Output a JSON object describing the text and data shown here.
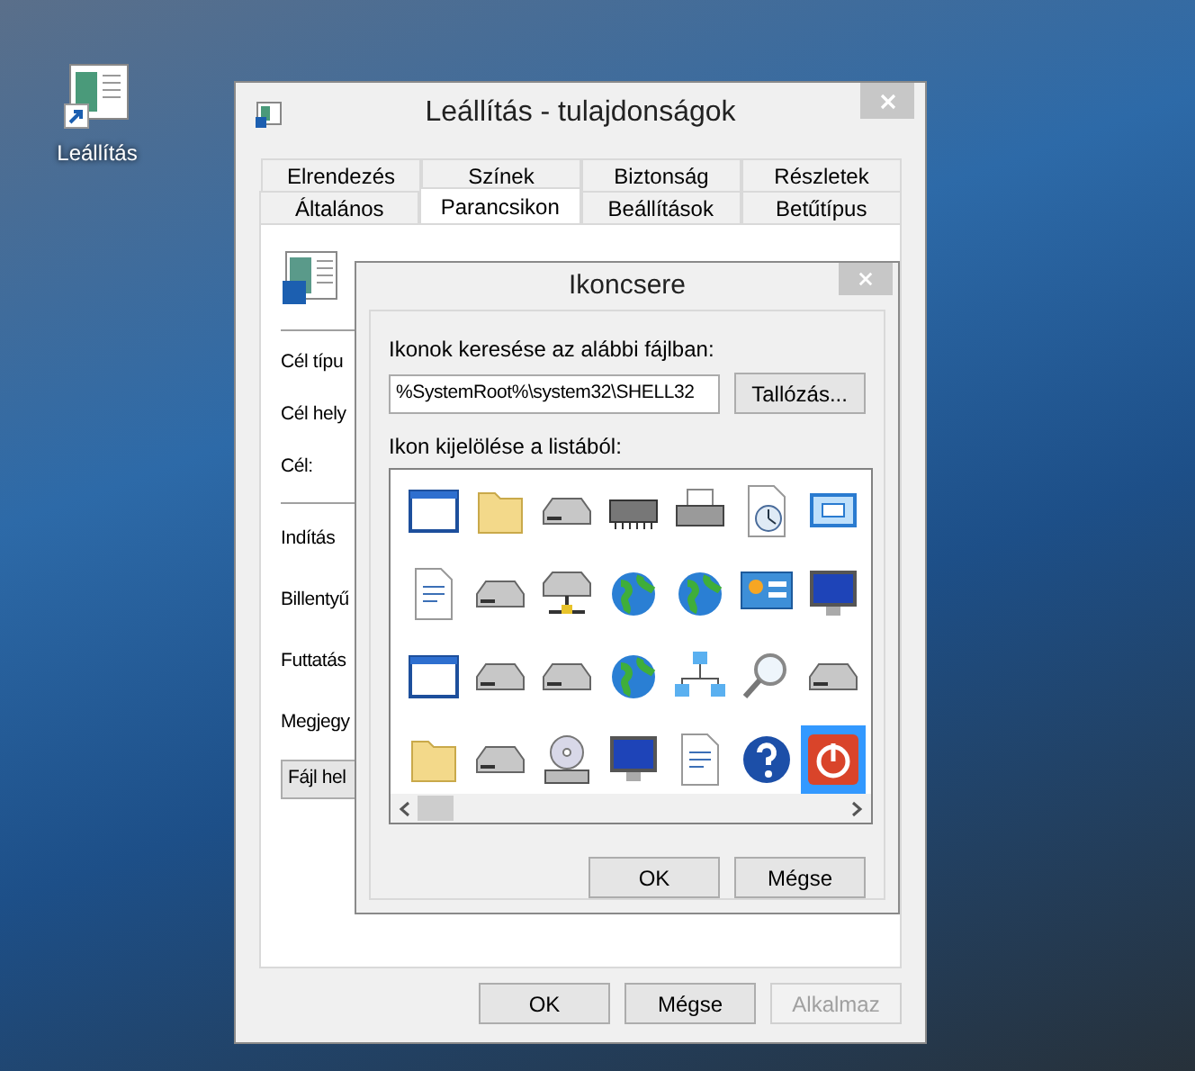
{
  "desktop_icon": {
    "label": "Leállítás"
  },
  "properties_window": {
    "title": "Leállítás - tulajdonságok",
    "tab_rows": [
      [
        {
          "label": "Elrendezés",
          "selected": false
        },
        {
          "label": "Színek",
          "selected": false
        },
        {
          "label": "Biztonság",
          "selected": false
        },
        {
          "label": "Részletek",
          "selected": false
        }
      ],
      [
        {
          "label": "Általános",
          "selected": false
        },
        {
          "label": "Parancsikon",
          "selected": true
        },
        {
          "label": "Beállítások",
          "selected": false
        },
        {
          "label": "Betűtípus",
          "selected": false
        }
      ]
    ],
    "fields_top": [
      "Cél típu",
      "Cél hely",
      "Cél:"
    ],
    "fields_bottom": [
      "Indítás",
      "Billentyű",
      "Futtatás",
      "Megjegy"
    ],
    "file_location_button": "Fájl hel",
    "buttons": [
      {
        "label": "OK",
        "disabled": false
      },
      {
        "label": "Mégse",
        "disabled": false
      },
      {
        "label": "Alkalmaz",
        "disabled": true
      }
    ]
  },
  "icon_dialog": {
    "title": "Ikoncsere",
    "search_label": "Ikonok keresése az alábbi fájlban:",
    "file_path": "%SystemRoot%\\system32\\SHELL32",
    "browse_button": "Tallózás...",
    "list_label": "Ikon kijelölése a listából:",
    "icons": [
      {
        "selected": false
      },
      {
        "selected": false
      },
      {
        "selected": false
      },
      {
        "selected": false
      },
      {
        "selected": false
      },
      {
        "selected": false
      },
      {
        "selected": false
      },
      {
        "selected": false
      },
      {
        "selected": false
      },
      {
        "selected": false
      },
      {
        "selected": false
      },
      {
        "selected": false
      },
      {
        "selected": false
      },
      {
        "selected": false
      },
      {
        "selected": false
      },
      {
        "selected": false
      },
      {
        "selected": false
      },
      {
        "selected": false
      },
      {
        "selected": false
      },
      {
        "selected": false
      },
      {
        "selected": false
      },
      {
        "selected": false
      },
      {
        "selected": false
      },
      {
        "selected": false
      },
      {
        "selected": false
      },
      {
        "selected": false
      },
      {
        "selected": false
      },
      {
        "selected": true
      }
    ],
    "buttons": [
      "OK",
      "Mégse"
    ]
  }
}
